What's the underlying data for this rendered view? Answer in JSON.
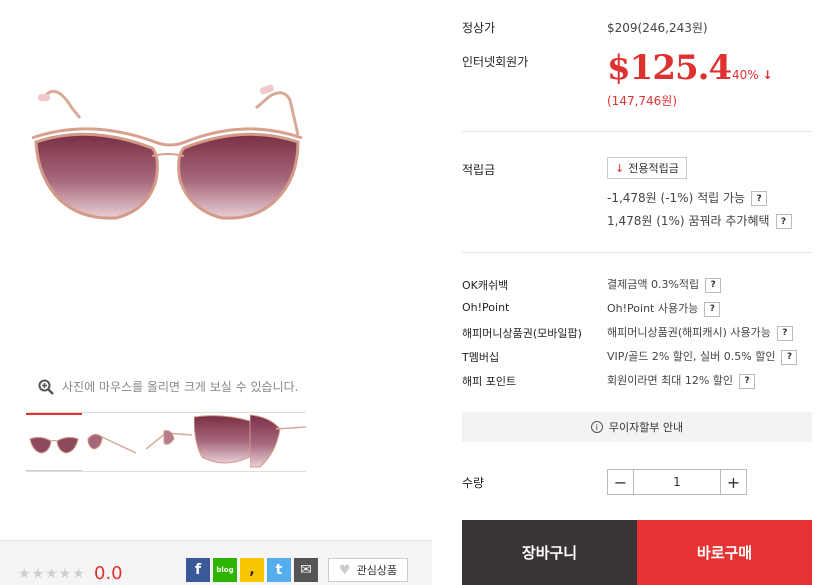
{
  "gallery": {
    "zoom_hint": "사진에 마우스를 올리면 크게 보실 수 있습니다.",
    "thumbnail_count": 5
  },
  "rating": {
    "stars_filled": 0,
    "stars_total": 5,
    "score": "0.0"
  },
  "social": {
    "facebook": "f",
    "blog": "blog",
    "kakao": ",",
    "twitter": "t",
    "mail": "✉"
  },
  "wishlist": {
    "label": "관심상품"
  },
  "price": {
    "regular_label": "정상가",
    "regular_value": "$209(246,243원)",
    "sale_label": "인터넷회원가",
    "sale_value": "$125.4",
    "discount": "40%",
    "sale_krw": "(147,746원)"
  },
  "reward": {
    "label": "적립금",
    "button": "전용적립금",
    "line1": "-1,478원 (-1%) 적립 가능",
    "line2": "1,478원 (1%) 꿈꿔라 추가혜택"
  },
  "benefits": [
    {
      "label": "OK캐쉬백",
      "value": "결제금액 0.3%적립"
    },
    {
      "label": "Oh!Point",
      "value": "Oh!Point 사용가능"
    },
    {
      "label": "해피머니상품권(모바일팝)",
      "value": "해피머니상품권(해피캐시) 사용가능"
    },
    {
      "label": "T멤버십",
      "value": "VIP/골드 2% 할인, 실버 0.5% 할인"
    },
    {
      "label": "해피 포인트",
      "value": "회원이라면 최대 12% 할인"
    }
  ],
  "help_mark": "?",
  "installment": {
    "icon": "i",
    "label": "무이자할부 안내"
  },
  "quantity": {
    "label": "수량",
    "minus": "−",
    "value": "1",
    "plus": "+"
  },
  "actions": {
    "cart": "장바구니",
    "buy": "바로구매"
  },
  "colors": {
    "accent": "#e03131",
    "cart_bg": "#3a3535",
    "buy_bg": "#e63232"
  }
}
